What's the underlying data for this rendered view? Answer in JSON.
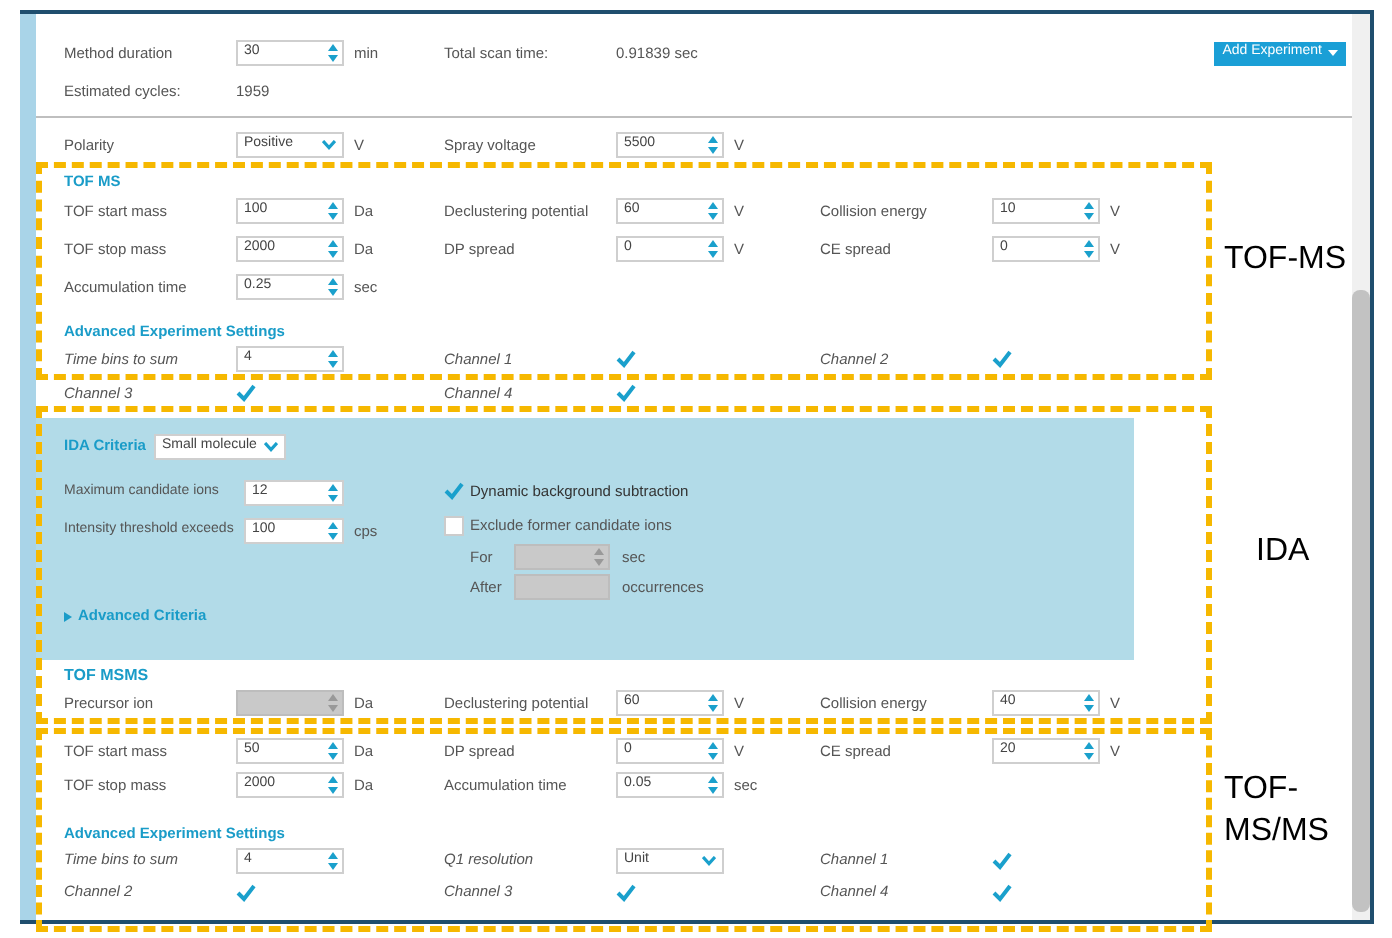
{
  "header": {
    "rows": [
      [
        {
          "label": "Method duration",
          "kind": "spin",
          "value": "30",
          "unit": "min",
          "disabled": false
        },
        {
          "label": "Total scan time:",
          "kind": "text",
          "value": "0.91839 sec"
        }
      ],
      [
        {
          "label": "Estimated cycles:",
          "kind": "text",
          "value": "1959"
        }
      ]
    ],
    "add_button": "Add Experiment"
  },
  "source": {
    "rows": [
      [
        {
          "label": "Polarity",
          "kind": "select",
          "value": "Positive",
          "unit": "V",
          "disabled": false
        },
        {
          "label": "Spray voltage",
          "kind": "spin",
          "value": "5500",
          "unit": "V",
          "disabled": false
        }
      ]
    ]
  },
  "tof_ms": {
    "title": "TOF MS",
    "rows": [
      [
        {
          "label": "TOF start mass",
          "kind": "spin",
          "value": "100",
          "unit": "Da",
          "disabled": false
        },
        {
          "label": "Declustering potential",
          "kind": "spin",
          "value": "60",
          "unit": "V",
          "disabled": false
        },
        {
          "label": "Collision energy",
          "kind": "spin",
          "value": "10",
          "unit": "V",
          "disabled": false
        }
      ],
      [
        {
          "label": "TOF stop mass",
          "kind": "spin",
          "value": "2000",
          "unit": "Da",
          "disabled": false
        },
        {
          "label": "DP spread",
          "kind": "spin",
          "value": "0",
          "unit": "V",
          "disabled": false
        },
        {
          "label": "CE spread",
          "kind": "spin",
          "value": "0",
          "unit": "V",
          "disabled": false
        }
      ],
      [
        {
          "label": "Accumulation time",
          "kind": "spin",
          "value": "0.25",
          "unit": "sec",
          "disabled": false
        }
      ]
    ],
    "advanced": {
      "title": "Advanced Experiment Settings",
      "rows": [
        [
          {
            "label": "Time bins to sum",
            "kind": "spin",
            "value": "4",
            "disabled": false
          },
          {
            "label": "Channel 1",
            "kind": "check",
            "checked": true
          },
          {
            "label": "Channel 2",
            "kind": "check",
            "checked": true
          }
        ],
        [
          {
            "label": "Channel 3",
            "kind": "check",
            "checked": true
          },
          {
            "label": "Channel 4",
            "kind": "check",
            "checked": true
          }
        ]
      ]
    }
  },
  "ida": {
    "criteria_label": "IDA Criteria",
    "criteria_select": "Small molecule",
    "left": [
      {
        "label": "Maximum candidate ions",
        "kind": "spin",
        "value": "12",
        "disabled": false
      },
      {
        "label": "Intensity threshold exceeds",
        "kind": "spin",
        "value": "100",
        "unit": "cps",
        "disabled": false
      }
    ],
    "options": [
      {
        "label": "Dynamic background subtraction",
        "checked": true
      },
      {
        "label": "Exclude former candidate ions",
        "checked": false
      }
    ],
    "sub_fields": [
      {
        "label": "For",
        "kind": "spin",
        "unit": "sec",
        "disabled": true
      },
      {
        "label": "After",
        "kind": "field",
        "unit": "occurrences",
        "disabled": true
      }
    ],
    "advanced_link": {
      "label": "Advanced Criteria",
      "expanded": false
    }
  },
  "tof_msms": {
    "title": "TOF MSMS",
    "rows": [
      [
        {
          "label": "Precursor ion",
          "kind": "spin",
          "unit": "Da",
          "disabled": true
        },
        {
          "label": "Declustering potential",
          "kind": "spin",
          "value": "60",
          "unit": "V",
          "disabled": false
        },
        {
          "label": "Collision energy",
          "kind": "spin",
          "value": "40",
          "unit": "V",
          "disabled": false
        }
      ],
      [
        {
          "label": "TOF start mass",
          "kind": "spin",
          "value": "50",
          "unit": "Da",
          "disabled": false
        },
        {
          "label": "DP spread",
          "kind": "spin",
          "value": "0",
          "unit": "V",
          "disabled": false
        },
        {
          "label": "CE spread",
          "kind": "spin",
          "value": "20",
          "unit": "V",
          "disabled": false
        }
      ],
      [
        {
          "label": "TOF stop mass",
          "kind": "spin",
          "value": "2000",
          "unit": "Da",
          "disabled": false
        },
        {
          "label": "Accumulation time",
          "kind": "spin",
          "value": "0.05",
          "unit": "sec",
          "disabled": false
        }
      ]
    ],
    "advanced": {
      "title": "Advanced Experiment Settings",
      "rows": [
        [
          {
            "label": "Time bins to sum",
            "kind": "spin",
            "value": "4",
            "disabled": false
          },
          {
            "label": "Q1 resolution",
            "kind": "select",
            "value": "Unit",
            "disabled": false
          },
          {
            "label": "Channel 1",
            "kind": "check",
            "checked": true
          }
        ],
        [
          {
            "label": "Channel 2",
            "kind": "check",
            "checked": true
          },
          {
            "label": "Channel 3",
            "kind": "check",
            "checked": true
          },
          {
            "label": "Channel 4",
            "kind": "check",
            "checked": true
          }
        ]
      ]
    }
  },
  "annotations": [
    {
      "label": "TOF-MS"
    },
    {
      "label": "IDA"
    },
    {
      "label": "TOF-MS/MS"
    }
  ]
}
